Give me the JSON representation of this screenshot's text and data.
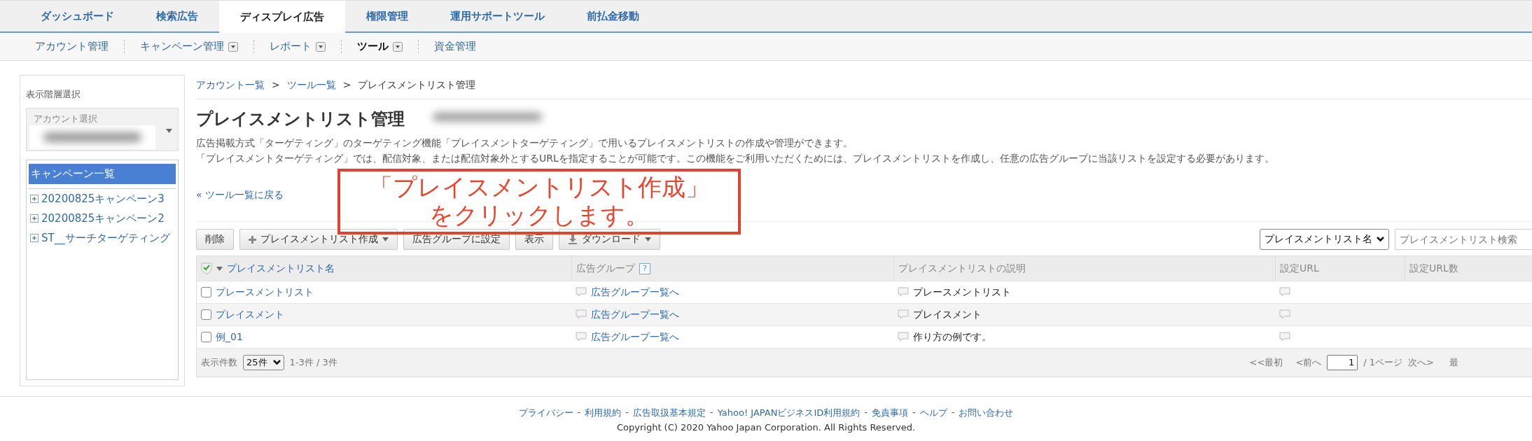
{
  "top_tabs": [
    {
      "label": "ダッシュボード",
      "selected": false
    },
    {
      "label": "検索広告",
      "selected": false
    },
    {
      "label": "ディスプレイ広告",
      "selected": true
    },
    {
      "label": "権限管理",
      "selected": false
    },
    {
      "label": "運用サポートツール",
      "selected": false
    },
    {
      "label": "前払金移動",
      "selected": false
    }
  ],
  "sub_nav": [
    {
      "label": "アカウント管理",
      "has_menu": false,
      "selected": false
    },
    {
      "label": "キャンペーン管理",
      "has_menu": true,
      "selected": false
    },
    {
      "label": "レポート",
      "has_menu": true,
      "selected": false
    },
    {
      "label": "ツール",
      "has_menu": true,
      "selected": true
    },
    {
      "label": "資金管理",
      "has_menu": false,
      "selected": false
    }
  ],
  "sidebar": {
    "title": "表示階層選択",
    "account_select": {
      "label": "アカウント選択"
    },
    "list_header": "キャンペーン一覧",
    "campaigns": [
      {
        "label": "20200825キャンペーン3",
        "expanded": false
      },
      {
        "label": "20200825キャンペーン2",
        "expanded": false
      },
      {
        "label": "ST__サーチターゲティング",
        "expanded": false
      }
    ]
  },
  "breadcrumb": [
    {
      "label": "アカウント一覧",
      "kind": "link"
    },
    {
      "label": ">",
      "kind": "separator"
    },
    {
      "label": "ツール一覧",
      "kind": "link"
    },
    {
      "label": ">",
      "kind": "separator"
    },
    {
      "label": "プレイスメントリスト管理",
      "kind": "current"
    }
  ],
  "title": "プレイスメントリスト管理",
  "description": [
    "広告掲載方式「ターゲティング」のターゲティング機能「プレイスメントターゲティング」で用いるプレイスメントリストの作成や管理ができます。",
    "「プレイスメントターゲティング」では、配信対象、または配信対象外とするURLを指定することが可能です。この機能をご利用いただくためには、プレイスメントリストを作成し、任意の広告グループに当該リストを設定する必要があります。"
  ],
  "back_link": {
    "mark": "«",
    "label": "ツール一覧に戻る"
  },
  "callout": {
    "lines": [
      "「プレイスメントリスト作成」",
      "をクリックします。"
    ]
  },
  "toolbar": [
    {
      "label": "削除",
      "kind": "plain"
    },
    {
      "label": "プレイスメントリスト作成",
      "kind": "create_menu"
    },
    {
      "label": "広告グループに設定",
      "kind": "plain"
    },
    {
      "label": "表示",
      "kind": "plain"
    },
    {
      "label": "ダウンロード",
      "kind": "download_menu"
    }
  ],
  "search": {
    "filter": "プレイスメントリスト名",
    "placeholder": "プレイスメントリスト検索"
  },
  "table": {
    "columns": [
      {
        "label": "プレイスメントリスト名",
        "kind": "sortable"
      },
      {
        "label": "広告グループ",
        "kind": "help",
        "help_mark": "?"
      },
      {
        "label": "プレイスメントリストの説明",
        "kind": "plain"
      },
      {
        "label": "設定URL",
        "kind": "plain"
      },
      {
        "label": "設定URL数",
        "kind": "plain"
      }
    ],
    "rows": [
      {
        "name": "プレースメントリスト",
        "checked": false,
        "ad_group": "広告グループ一覧へ",
        "description": "プレースメントリスト"
      },
      {
        "name": "プレイスメント",
        "checked": false,
        "ad_group": "広告グループ一覧へ",
        "description": "プレイスメント"
      },
      {
        "name": "例_01",
        "checked": false,
        "ad_group": "広告グループ一覧へ",
        "description": "作り方の例です。"
      }
    ],
    "footer": {
      "page_size_label": "表示件数",
      "page_size": "25件",
      "count": "1-3件 / 3件",
      "first": "<<最初",
      "prev": "<前へ",
      "page": "1",
      "total": "/ 1ページ",
      "next": "次へ>",
      "last": "最"
    }
  },
  "site_footer": {
    "links": [
      {
        "label": "プライバシー",
        "kind": "link"
      },
      {
        "label": "-",
        "kind": "separator"
      },
      {
        "label": "利用規約",
        "kind": "link"
      },
      {
        "label": "-",
        "kind": "separator"
      },
      {
        "label": "広告取扱基本規定",
        "kind": "link"
      },
      {
        "label": "-",
        "kind": "separator"
      },
      {
        "label": "Yahoo! JAPANビジネスID利用規約",
        "kind": "link"
      },
      {
        "label": "-",
        "kind": "separator"
      },
      {
        "label": "免責事項",
        "kind": "link"
      },
      {
        "label": "-",
        "kind": "separator"
      },
      {
        "label": "ヘルプ",
        "kind": "link"
      },
      {
        "label": "-",
        "kind": "separator"
      },
      {
        "label": "お問い合わせ",
        "kind": "link"
      }
    ],
    "copyright": "Copyright (C) 2020 Yahoo Japan Corporation. All Rights Reserved."
  }
}
